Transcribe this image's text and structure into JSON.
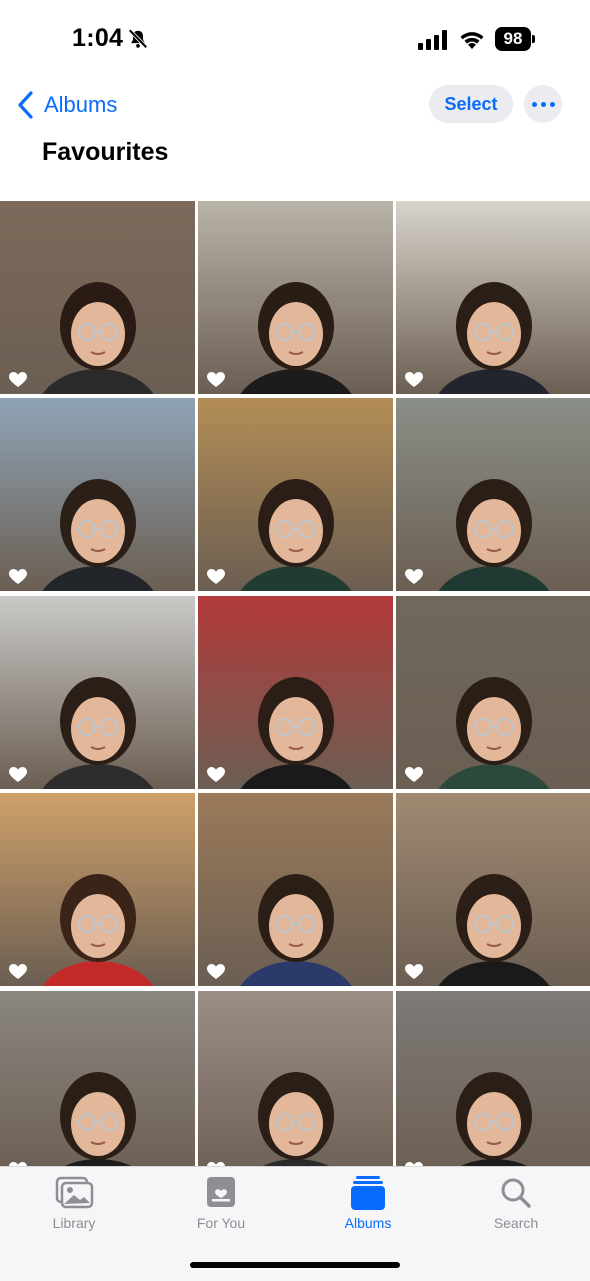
{
  "status_bar": {
    "time": "1:04",
    "battery": "98"
  },
  "nav": {
    "back_label": "Albums",
    "select_label": "Select",
    "title": "Favourites"
  },
  "photos": [
    {
      "bg": "#7b6a5a",
      "shirt": "#2b2b2b",
      "hair": "#2a1c14"
    },
    {
      "bg": "#b9b3a8",
      "shirt": "#1c1c1c",
      "hair": "#2a1d16"
    },
    {
      "bg": "#d8d4cc",
      "shirt": "#23252e",
      "hair": "#2a1e17"
    },
    {
      "bg": "#8fa4b6",
      "shirt": "#22252a",
      "hair": "#2b1f18"
    },
    {
      "bg": "#b38d55",
      "shirt": "#1f3b32",
      "hair": "#2b1e16"
    },
    {
      "bg": "#8a8f88",
      "shirt": "#1f3a33",
      "hair": "#2b1e16"
    },
    {
      "bg": "#c9c9c7",
      "shirt": "#2d2d2d",
      "hair": "#2b1e16"
    },
    {
      "bg": "#b33b3b",
      "shirt": "#1a1a1a",
      "hair": "#2b1e16"
    },
    {
      "bg": "#6f6a5c",
      "shirt": "#2b4a3b",
      "hair": "#2b1e16"
    },
    {
      "bg": "#cfa06a",
      "shirt": "#c42a2a",
      "hair": "#3a2418"
    },
    {
      "bg": "#9a7a5a",
      "shirt": "#2a3a6a",
      "hair": "#2b1e16"
    },
    {
      "bg": "#a08a72",
      "shirt": "#1a1a1a",
      "hair": "#2b1e16"
    },
    {
      "bg": "#8a8680",
      "shirt": "#1c1c1c",
      "hair": "#2b1e16"
    },
    {
      "bg": "#9c8e86",
      "shirt": "#2a2a2a",
      "hair": "#2b1e16"
    },
    {
      "bg": "#7e7a78",
      "shirt": "#1c1c1c",
      "hair": "#2b1e16"
    }
  ],
  "tabs": [
    {
      "label": "Library",
      "icon": "library-icon"
    },
    {
      "label": "For You",
      "icon": "for-you-icon"
    },
    {
      "label": "Albums",
      "icon": "albums-icon"
    },
    {
      "label": "Search",
      "icon": "search-icon"
    }
  ],
  "colors": {
    "accent": "#0a6cff",
    "inactive": "#8e8e93"
  }
}
